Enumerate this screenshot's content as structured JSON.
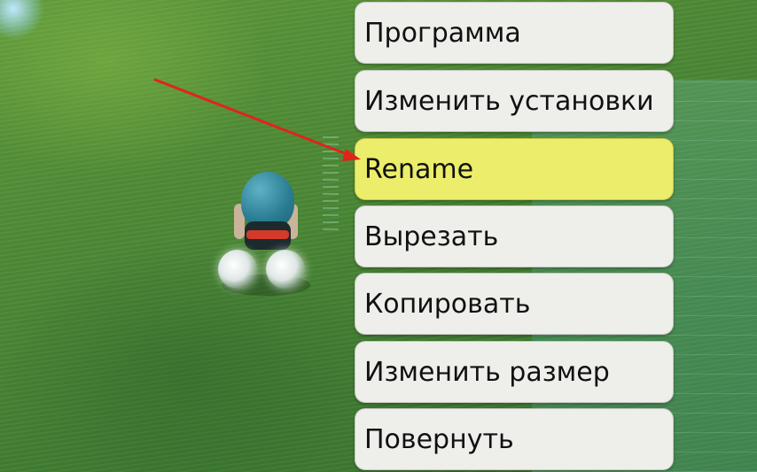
{
  "menu": {
    "items": [
      {
        "label": "Программа"
      },
      {
        "label": "Изменить установки"
      },
      {
        "label": "Rename",
        "highlighted": true
      },
      {
        "label": "Вырезать"
      },
      {
        "label": "Копировать"
      },
      {
        "label": "Изменить размер"
      },
      {
        "label": "Повернуть"
      }
    ]
  },
  "annotation": {
    "type": "arrow",
    "color": "#e2231a",
    "points_to": "Rename"
  },
  "colors": {
    "menu_bg": "#eeeeea",
    "highlight_bg": "#eced6a",
    "grass": "#4e8a36"
  }
}
